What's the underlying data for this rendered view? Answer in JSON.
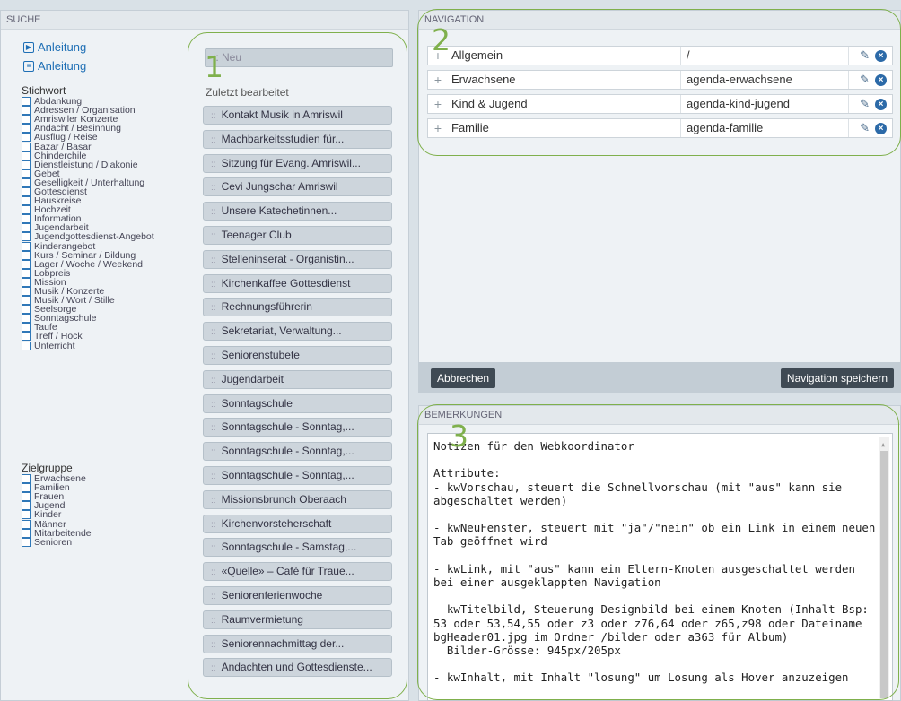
{
  "suche": {
    "header": "SUCHE",
    "anleitung": [
      "Anleitung",
      "Anleitung"
    ],
    "stichwort_title": "Stichwort",
    "stichwort": [
      "Abdankung",
      "Adressen / Organisation",
      "Amriswiler Konzerte",
      "Andacht / Besinnung",
      "Ausflug / Reise",
      "Bazar / Basar",
      "Chinderchile",
      "Dienstleistung / Diakonie",
      "Gebet",
      "Geselligkeit / Unterhaltung",
      "Gottesdienst",
      "Hauskreise",
      "Hochzeit",
      "Information",
      "Jugendarbeit",
      "Jugendgottesdienst-Angebot",
      "Kinderangebot",
      "Kurs / Seminar / Bildung",
      "Lager / Woche / Weekend",
      "Lobpreis",
      "Mission",
      "Musik / Konzerte",
      "Musik / Wort / Stille",
      "Seelsorge",
      "Sonntagschule",
      "Taufe",
      "Treff / Höck",
      "Unterricht"
    ],
    "zielgruppe_title": "Zielgruppe",
    "zielgruppe": [
      "Erwachsene",
      "Familien",
      "Frauen",
      "Jugend",
      "Kinder",
      "Männer",
      "Mitarbeitende",
      "Senioren"
    ],
    "neu": "Neu",
    "zuletzt": "Zuletzt bearbeitet",
    "recent": [
      "Kontakt Musik in Amriswil",
      "Machbarkeitsstudien für...",
      "Sitzung für Evang. Amriswil...",
      "Cevi Jungschar Amriswil",
      "Unsere Katechetinnen...",
      "Teenager Club",
      "Stelleninserat - Organistin...",
      "Kirchenkaffee Gottesdienst",
      "Rechnungsführerin",
      "Sekretariat, Verwaltung...",
      "Seniorenstubete",
      "Jugendarbeit",
      "Sonntagschule",
      "Sonntagschule - Sonntag,...",
      "Sonntagschule - Sonntag,...",
      "Sonntagschule - Sonntag,...",
      "Missionsbrunch Oberaach",
      "Kirchenvorsteherschaft",
      "Sonntagschule - Samstag,...",
      "«Quelle» – Café für Traue...",
      "Seniorenferienwoche",
      "Raumvermietung",
      "Seniorennachmittag der...",
      "Andachten und Gottesdienste..."
    ]
  },
  "navigation": {
    "header": "NAVIGATION",
    "rows": [
      {
        "name": "Allgemein",
        "url": "/"
      },
      {
        "name": "Erwachsene",
        "url": "agenda-erwachsene"
      },
      {
        "name": "Kind & Jugend",
        "url": "agenda-kind-jugend"
      },
      {
        "name": "Familie",
        "url": "agenda-familie"
      }
    ],
    "cancel": "Abbrechen",
    "save": "Navigation speichern"
  },
  "bemerkungen": {
    "header": "BEMERKUNGEN",
    "text": "Notizen für den Webkoordinator\n\nAttribute:\n- kwVorschau, steuert die Schnellvorschau (mit \"aus\" kann sie abgeschaltet werden)\n\n- kwNeuFenster, steuert mit \"ja\"/\"nein\" ob ein Link in einem neuen Tab geöffnet wird\n\n- kwLink, mit \"aus\" kann ein Eltern-Knoten ausgeschaltet werden bei einer ausgeklappten Navigation\n\n- kwTitelbild, Steuerung Designbild bei einem Knoten (Inhalt Bsp: 53 oder 53,54,55 oder z3 oder z76,64 oder z65,z98 oder Dateiname bgHeader01.jpg im Ordner /bilder oder a363 für Album)\n  Bilder-Grösse: 945px/205px\n\n- kwInhalt, mit Inhalt \"losung\" um Losung als Hover anzuzeigen"
  },
  "markers": [
    "1",
    "2",
    "3"
  ],
  "colors": {
    "accent": "#7fb04c",
    "link": "#1e6fb5",
    "button": "#3f4a54"
  }
}
